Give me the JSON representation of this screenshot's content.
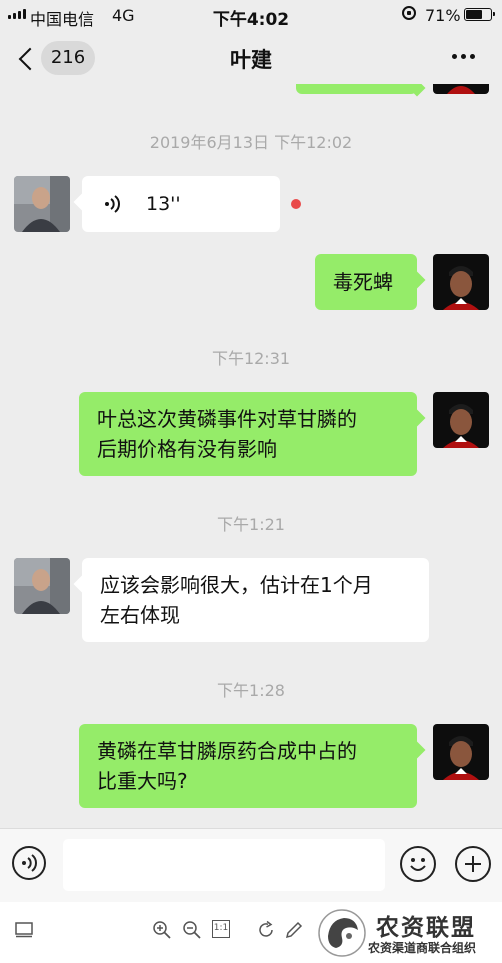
{
  "status": {
    "carrier": "中国电信",
    "network": "4G",
    "time": "下午4:02",
    "battery_pct": "71%",
    "battery_level": 0.71
  },
  "nav": {
    "back_count": "216",
    "title": "叶建",
    "more_icon": "more-dots-icon"
  },
  "chat": {
    "messages": [
      {
        "kind": "timestamp",
        "text": "2019年6月13日 下午12:02"
      },
      {
        "kind": "voice",
        "side": "incoming",
        "duration": "13''",
        "unread": true
      },
      {
        "kind": "text",
        "side": "outgoing",
        "text": "毒死蜱"
      },
      {
        "kind": "timestamp",
        "text": "下午12:31"
      },
      {
        "kind": "text",
        "side": "outgoing",
        "lines": [
          "叶总这次黄磷事件对草甘膦的",
          "后期价格有没有影响"
        ]
      },
      {
        "kind": "timestamp",
        "text": "下午1:21"
      },
      {
        "kind": "text",
        "side": "incoming",
        "lines": [
          "应该会影响很大，估计在1个月",
          "左右体现"
        ]
      },
      {
        "kind": "timestamp",
        "text": "下午1:28"
      },
      {
        "kind": "text",
        "side": "outgoing",
        "lines": [
          "黄磷在草甘膦原药合成中占的",
          "比重大吗?"
        ]
      }
    ]
  },
  "input": {
    "placeholder": "",
    "value": ""
  },
  "toolbar": {
    "icons": [
      "screen-icon",
      "zoom-in-icon",
      "zoom-out-icon",
      "actual-size-icon",
      "rotate-icon",
      "pencil-icon"
    ],
    "actual_size_label": "1:1"
  },
  "watermark": {
    "title": "农资联盟",
    "subtitle": "农资渠道商联合组织"
  },
  "colors": {
    "background": "#ededed",
    "outgoing_bubble": "#95ec69",
    "incoming_bubble": "#ffffff",
    "unread_dot": "#e94a4a"
  }
}
